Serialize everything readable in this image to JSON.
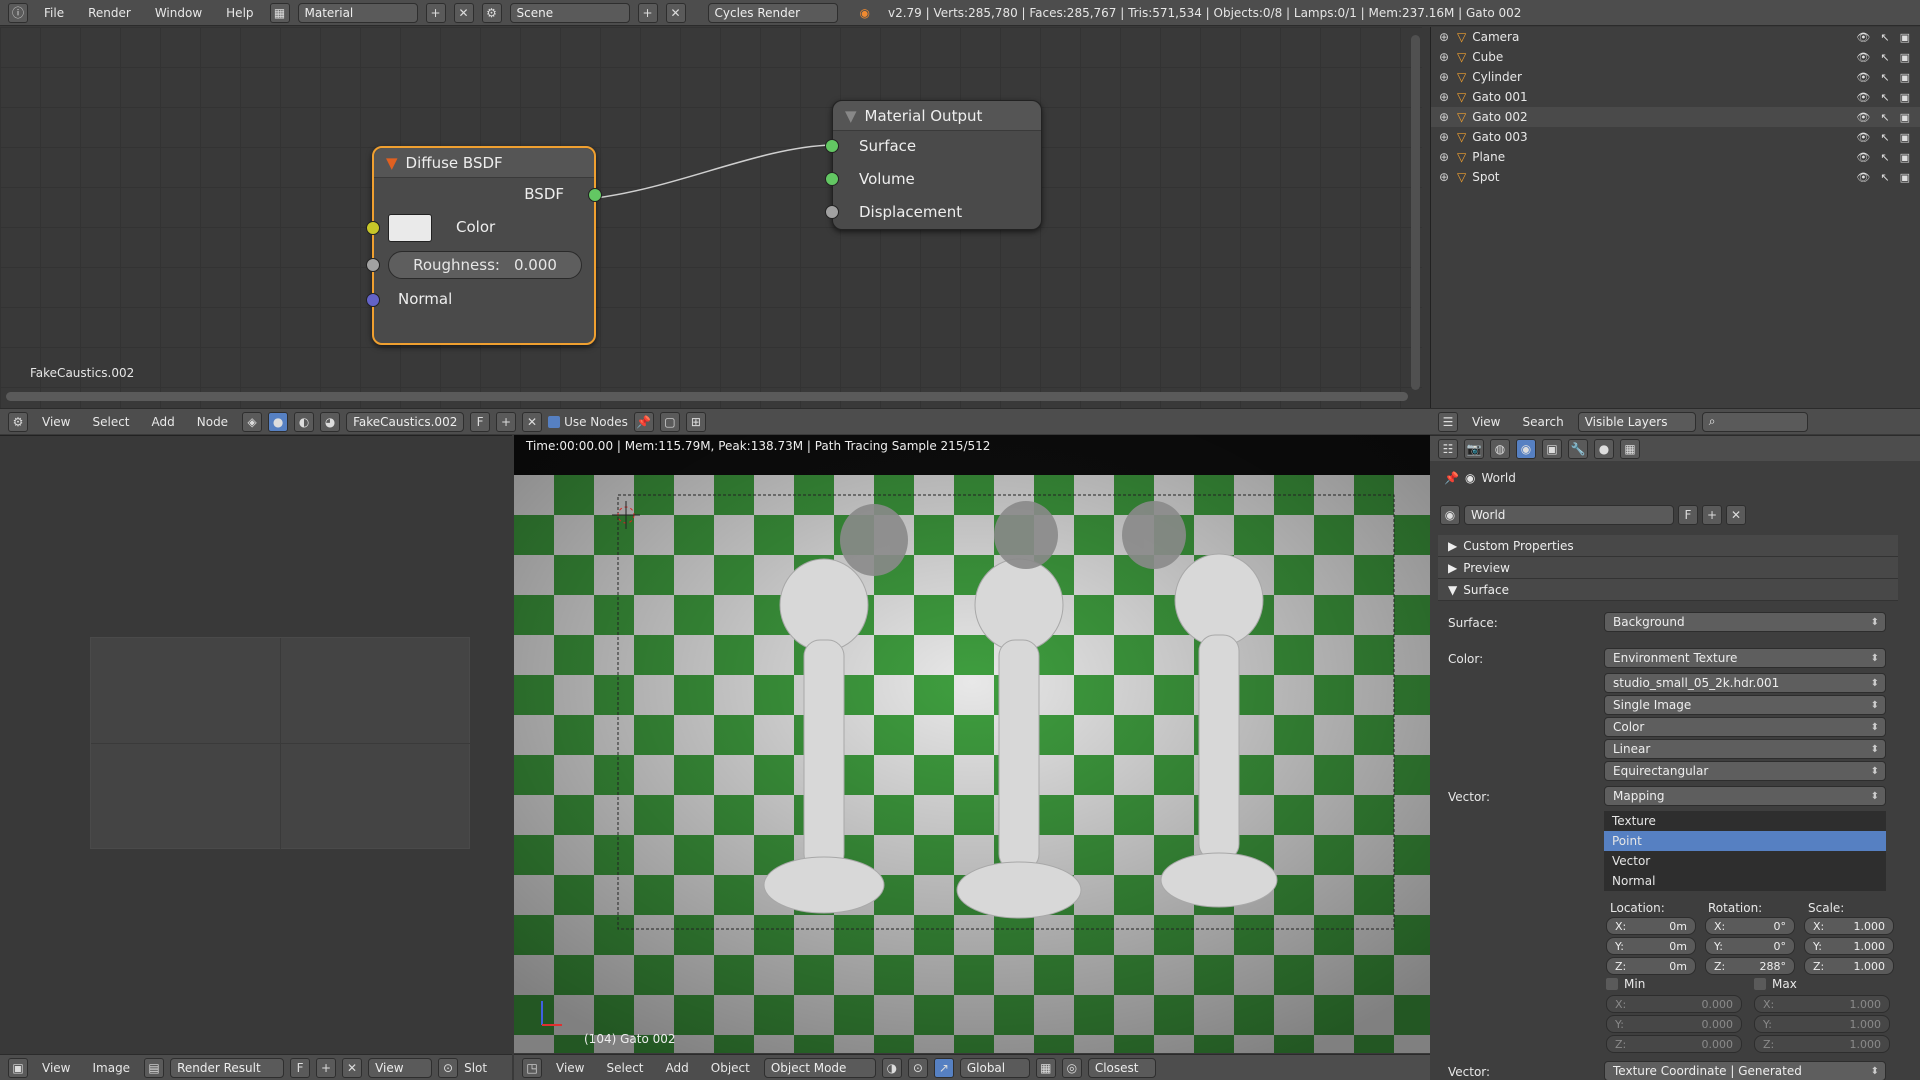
{
  "topbar": {
    "menus": [
      "File",
      "Render",
      "Window",
      "Help"
    ],
    "screen_layout": "Material",
    "scene": "Scene",
    "engine": "Cycles Render",
    "stats": "v2.79 | Verts:285,780 | Faces:285,767 | Tris:571,534 | Objects:0/8 | Lamps:0/1 | Mem:237.16M | Gato 002"
  },
  "node_editor": {
    "diffuse": {
      "title": "Diffuse BSDF",
      "output": "BSDF",
      "color": "Color",
      "roughness": "Roughness:",
      "roughness_value": "0.000",
      "normal": "Normal"
    },
    "output": {
      "title": "Material Output",
      "surface": "Surface",
      "volume": "Volume",
      "displacement": "Displacement"
    },
    "material_name": "FakeCaustics.002",
    "header": {
      "menus": [
        "View",
        "Select",
        "Add",
        "Node"
      ],
      "material": "FakeCaustics.002",
      "f": "F",
      "use_nodes": "Use Nodes"
    }
  },
  "outliner": {
    "items": [
      "Camera",
      "Cube",
      "Cylinder",
      "Gato 001",
      "Gato 002",
      "Gato 003",
      "Plane",
      "Spot"
    ],
    "header": {
      "view": "View",
      "search": "Search",
      "filter": "Visible Layers"
    }
  },
  "image_editor": {
    "header": {
      "menus": [
        "View",
        "Image"
      ],
      "image": "Render Result",
      "f": "F",
      "view": "View",
      "slot": "Slot"
    }
  },
  "viewport": {
    "status": "Time:00:00.00 | Mem:115.79M, Peak:138.73M | Path Tracing Sample 215/512",
    "object_label": "(104) Gato 002",
    "header": {
      "menus": [
        "View",
        "Select",
        "Add",
        "Object"
      ],
      "mode": "Object Mode",
      "orientation": "Global",
      "snap": "Closest"
    }
  },
  "properties": {
    "breadcrumb": "World",
    "world_name": "World",
    "f": "F",
    "panels": {
      "custom": "Custom Properties",
      "preview": "Preview",
      "surface": "Surface"
    },
    "surface_label": "Surface:",
    "surface_value": "Background",
    "color_label": "Color:",
    "color_value": "Environment Texture",
    "image_name": "studio_small_05_2k.hdr.001",
    "source": "Single Image",
    "colorspace": "Color",
    "interp": "Linear",
    "projection": "Equirectangular",
    "vector_label": "Vector:",
    "vector_value": "Mapping",
    "mapping_types": [
      "Texture",
      "Point",
      "Vector",
      "Normal"
    ],
    "mapping_selected": "Point",
    "location_label": "Location:",
    "rotation_label": "Rotation:",
    "scale_label": "Scale:",
    "location": [
      {
        "axis": "X:",
        "value": "0m"
      },
      {
        "axis": "Y:",
        "value": "0m"
      },
      {
        "axis": "Z:",
        "value": "0m"
      }
    ],
    "rotation": [
      {
        "axis": "X:",
        "value": "0°"
      },
      {
        "axis": "Y:",
        "value": "0°"
      },
      {
        "axis": "Z:",
        "value": "288°"
      }
    ],
    "scale": [
      {
        "axis": "X:",
        "value": "1.000"
      },
      {
        "axis": "Y:",
        "value": "1.000"
      },
      {
        "axis": "Z:",
        "value": "1.000"
      }
    ],
    "min_label": "Min",
    "max_label": "Max",
    "min": [
      {
        "axis": "X:",
        "value": "0.000"
      },
      {
        "axis": "Y:",
        "value": "0.000"
      },
      {
        "axis": "Z:",
        "value": "0.000"
      }
    ],
    "max": [
      {
        "axis": "X:",
        "value": "1.000"
      },
      {
        "axis": "Y:",
        "value": "1.000"
      },
      {
        "axis": "Z:",
        "value": "1.000"
      }
    ],
    "vector2_label": "Vector:",
    "vector2_value": "Texture Coordinate | Generated"
  },
  "colors": {
    "accent_blue": "#5680c2",
    "socket_green": "#63c763",
    "socket_yellow": "#c7c729",
    "socket_grey": "#a1a1a1",
    "socket_blue": "#6363c7",
    "node_selected": "#f0a030",
    "checker_green": "#3f9e3f"
  }
}
